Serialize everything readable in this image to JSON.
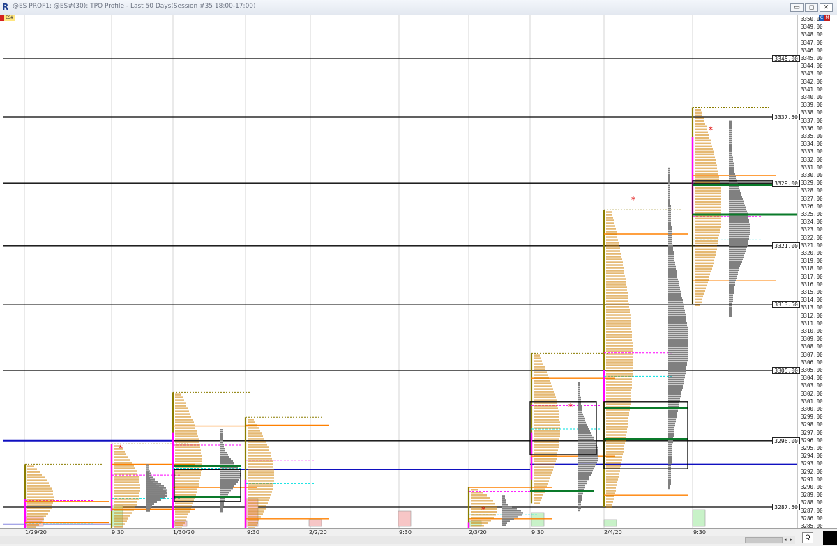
{
  "window": {
    "title": "@ES PROF1: @ES#(30): TPO Profile - Last 50 Days(Session #35 18:00-17:00)",
    "minimize": "▭",
    "restore": "◻",
    "close": "✕",
    "app_icon": "R"
  },
  "symbol_tag": "ES#",
  "axis_top_marks": [
    "C",
    "M"
  ],
  "price_axis": {
    "min": 3285,
    "max": 3350,
    "labels": [
      "3350.0",
      "3349.00",
      "3348.00",
      "3347.00",
      "3346.00",
      "3345.00",
      "3344.00",
      "3343.00",
      "3342.00",
      "3341.00",
      "3340.00",
      "3339.00",
      "3338.00",
      "3337.00",
      "3336.00",
      "3335.00",
      "3334.00",
      "3333.00",
      "3332.00",
      "3331.00",
      "3330.00",
      "3329.00",
      "3328.00",
      "3327.00",
      "3326.00",
      "3325.00",
      "3324.00",
      "3323.00",
      "3322.00",
      "3321.00",
      "3320.00",
      "3319.00",
      "3318.00",
      "3317.00",
      "3316.00",
      "3315.00",
      "3314.00",
      "3313.00",
      "3312.00",
      "3311.00",
      "3310.00",
      "3309.00",
      "3308.00",
      "3307.00",
      "3306.00",
      "3305.00",
      "3304.00",
      "3303.00",
      "3302.00",
      "3301.00",
      "3300.00",
      "3299.00",
      "3298.00",
      "3297.00",
      "3296.00",
      "3295.00",
      "3294.00",
      "3293.00",
      "3292.00",
      "3291.00",
      "3290.00",
      "3289.00",
      "3288.00",
      "3287.00",
      "3286.00",
      "3285.00"
    ]
  },
  "levels": [
    {
      "price": 3345.0,
      "label": "3345.00"
    },
    {
      "price": 3337.5,
      "label": "3337.50"
    },
    {
      "price": 3329.0,
      "label": "3329.00"
    },
    {
      "price": 3321.0,
      "label": "3321.00"
    },
    {
      "price": 3313.5,
      "label": "3313.50"
    },
    {
      "price": 3305.0,
      "label": "3305.00"
    },
    {
      "price": 3296.0,
      "label": "3296.00"
    },
    {
      "price": 3287.5,
      "label": "3287.50"
    }
  ],
  "x_labels": [
    "1/29/20",
    "9:30",
    "1/30/20",
    "9:30",
    "2/2/20",
    "9:30",
    "2/3/20",
    "9:30",
    "2/4/20",
    "9:30"
  ],
  "colors": {
    "level_line": "#000000",
    "value_area_high": "#ff8000",
    "poc_line": "#1010c0",
    "poc_green": "#0a7a2a",
    "range_bar": "#8b7d00",
    "ib_magenta": "#ff00ff",
    "ib_cyan": "#00e0e0",
    "volume_profile": "#808080",
    "volume_bar_up": "#c8f2c8",
    "volume_bar_down": "#f7c6c6",
    "tpo_text": "#d08000"
  },
  "scroll": {
    "left_arrow": "◂",
    "right_arrow": "▸"
  },
  "zoom_icon": "Q"
}
